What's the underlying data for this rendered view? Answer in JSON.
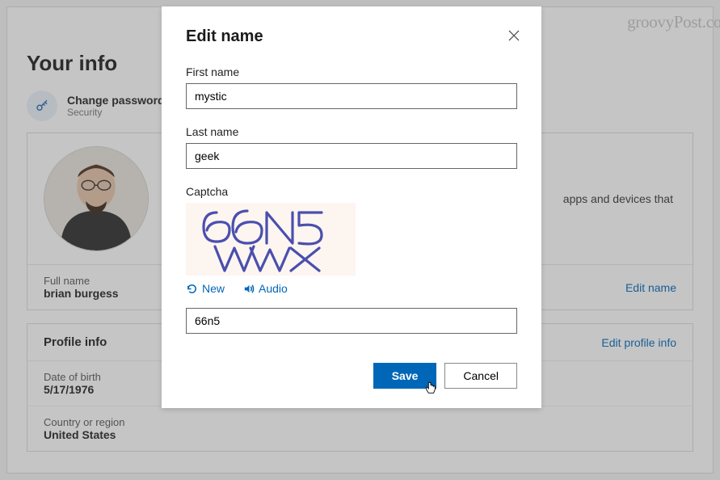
{
  "watermark": "groovyPost.com",
  "page": {
    "title": "Your info",
    "change_password": "Change password",
    "security": "Security"
  },
  "card_top": {
    "right_text": "apps and devices that",
    "full_name_label": "Full name",
    "full_name_value": "brian burgess",
    "edit_name_link": "Edit name"
  },
  "profile": {
    "title": "Profile info",
    "edit_link": "Edit profile info",
    "dob_label": "Date of birth",
    "dob_value": "5/17/1976",
    "country_label": "Country or region",
    "country_value": "United States"
  },
  "modal": {
    "title": "Edit name",
    "first_name_label": "First name",
    "first_name_value": "mystic",
    "last_name_label": "Last name",
    "last_name_value": "geek",
    "captcha_label": "Captcha",
    "captcha_text": "66N5 WWX",
    "new_label": "New",
    "audio_label": "Audio",
    "captcha_input_value": "66n5",
    "save_label": "Save",
    "cancel_label": "Cancel"
  }
}
